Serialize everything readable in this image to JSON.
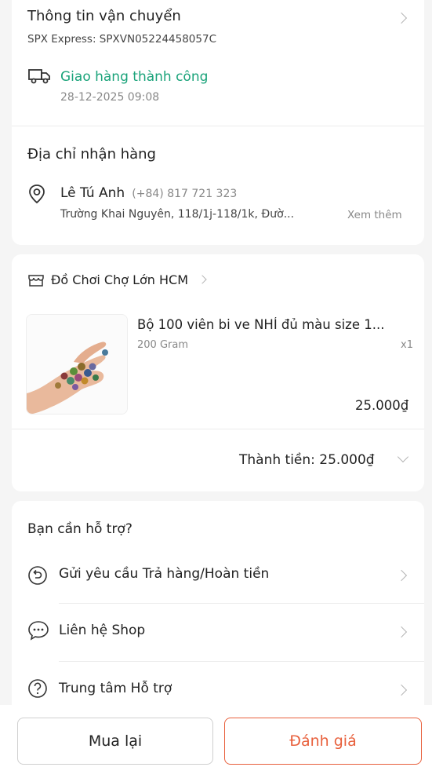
{
  "shipping": {
    "title": "Thông tin vận chuyển",
    "carrier": "SPX Express: SPXVN05224458057C",
    "status": "Giao hàng thành công",
    "status_time": "28-12-2025 09:08"
  },
  "address": {
    "title": "Địa chỉ nhận hàng",
    "name": "Lê Tú Anh",
    "phone": "(+84) 817 721 323",
    "line": "Trường Khai Nguyên, 118/1j-118/1k, Đườ...",
    "more": "Xem thêm"
  },
  "shop": {
    "name": "Đồ Chơi Chợ Lớn HCM"
  },
  "product": {
    "name": "Bộ 100 viên bi ve NHÍ đủ màu size 1...",
    "variant": "200 Gram",
    "qty": "x1",
    "price": "25.000₫"
  },
  "order_total": {
    "label": "Thành tiền: 25.000₫"
  },
  "support": {
    "title": "Bạn cần hỗ trợ?",
    "items": [
      {
        "label": "Gửi yêu cầu Trả hàng/Hoàn tiền",
        "icon": "return-icon"
      },
      {
        "label": "Liên hệ Shop",
        "icon": "chat-icon"
      },
      {
        "label": "Trung tâm Hỗ trợ",
        "icon": "help-icon"
      }
    ]
  },
  "footer": {
    "buy_again": "Mua lại",
    "rate": "Đánh giá"
  },
  "colors": {
    "accent": "#e8603c",
    "success": "#1aa37a"
  }
}
